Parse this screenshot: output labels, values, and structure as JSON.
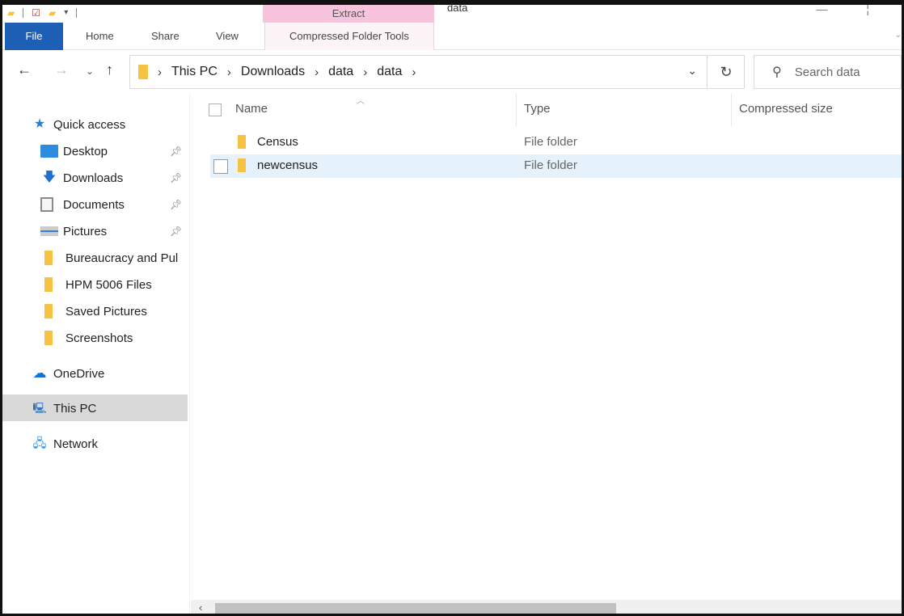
{
  "window": {
    "title": "data"
  },
  "ribbon": {
    "context_header": "Extract",
    "tabs": {
      "file": "File",
      "home": "Home",
      "share": "Share",
      "view": "View",
      "context": "Compressed Folder Tools"
    }
  },
  "address": {
    "crumbs": [
      "This PC",
      "Downloads",
      "data",
      "data"
    ],
    "search_placeholder": "Search data"
  },
  "nav_pane": {
    "quick_access": "Quick access",
    "items": [
      {
        "label": "Desktop",
        "icon": "desktop-icon",
        "pinned": true
      },
      {
        "label": "Downloads",
        "icon": "download-arrow-icon",
        "pinned": true
      },
      {
        "label": "Documents",
        "icon": "document-icon",
        "pinned": true
      },
      {
        "label": "Pictures",
        "icon": "pictures-icon",
        "pinned": true
      },
      {
        "label": "Bureaucracy and Pul",
        "icon": "folder-icon",
        "pinned": false
      },
      {
        "label": "HPM 5006 Files",
        "icon": "folder-icon",
        "pinned": false
      },
      {
        "label": "Saved Pictures",
        "icon": "folder-icon",
        "pinned": false
      },
      {
        "label": "Screenshots",
        "icon": "folder-icon",
        "pinned": false
      }
    ],
    "onedrive": "OneDrive",
    "this_pc": "This PC",
    "network": "Network"
  },
  "file_list": {
    "columns": [
      "Name",
      "Type",
      "Compressed size"
    ],
    "rows": [
      {
        "name": "Census",
        "type": "File folder",
        "selected": false
      },
      {
        "name": "newcensus",
        "type": "File folder",
        "selected": true
      }
    ]
  },
  "colors": {
    "file_tab": "#1c5fb4",
    "context_tab_header": "#f8c3dc",
    "folder": "#f5c242",
    "selection": "#e5f1fb"
  }
}
